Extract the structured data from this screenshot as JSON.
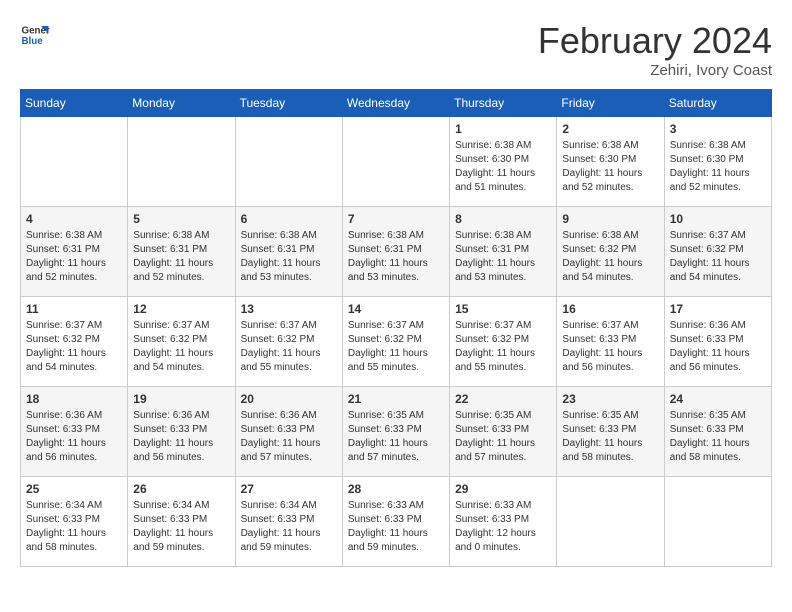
{
  "header": {
    "logo_line1": "General",
    "logo_line2": "Blue",
    "month": "February 2024",
    "location": "Zehiri, Ivory Coast"
  },
  "days_of_week": [
    "Sunday",
    "Monday",
    "Tuesday",
    "Wednesday",
    "Thursday",
    "Friday",
    "Saturday"
  ],
  "weeks": [
    [
      {
        "day": "",
        "detail": ""
      },
      {
        "day": "",
        "detail": ""
      },
      {
        "day": "",
        "detail": ""
      },
      {
        "day": "",
        "detail": ""
      },
      {
        "day": "1",
        "detail": "Sunrise: 6:38 AM\nSunset: 6:30 PM\nDaylight: 11 hours\nand 51 minutes."
      },
      {
        "day": "2",
        "detail": "Sunrise: 6:38 AM\nSunset: 6:30 PM\nDaylight: 11 hours\nand 52 minutes."
      },
      {
        "day": "3",
        "detail": "Sunrise: 6:38 AM\nSunset: 6:30 PM\nDaylight: 11 hours\nand 52 minutes."
      }
    ],
    [
      {
        "day": "4",
        "detail": "Sunrise: 6:38 AM\nSunset: 6:31 PM\nDaylight: 11 hours\nand 52 minutes."
      },
      {
        "day": "5",
        "detail": "Sunrise: 6:38 AM\nSunset: 6:31 PM\nDaylight: 11 hours\nand 52 minutes."
      },
      {
        "day": "6",
        "detail": "Sunrise: 6:38 AM\nSunset: 6:31 PM\nDaylight: 11 hours\nand 53 minutes."
      },
      {
        "day": "7",
        "detail": "Sunrise: 6:38 AM\nSunset: 6:31 PM\nDaylight: 11 hours\nand 53 minutes."
      },
      {
        "day": "8",
        "detail": "Sunrise: 6:38 AM\nSunset: 6:31 PM\nDaylight: 11 hours\nand 53 minutes."
      },
      {
        "day": "9",
        "detail": "Sunrise: 6:38 AM\nSunset: 6:32 PM\nDaylight: 11 hours\nand 54 minutes."
      },
      {
        "day": "10",
        "detail": "Sunrise: 6:37 AM\nSunset: 6:32 PM\nDaylight: 11 hours\nand 54 minutes."
      }
    ],
    [
      {
        "day": "11",
        "detail": "Sunrise: 6:37 AM\nSunset: 6:32 PM\nDaylight: 11 hours\nand 54 minutes."
      },
      {
        "day": "12",
        "detail": "Sunrise: 6:37 AM\nSunset: 6:32 PM\nDaylight: 11 hours\nand 54 minutes."
      },
      {
        "day": "13",
        "detail": "Sunrise: 6:37 AM\nSunset: 6:32 PM\nDaylight: 11 hours\nand 55 minutes."
      },
      {
        "day": "14",
        "detail": "Sunrise: 6:37 AM\nSunset: 6:32 PM\nDaylight: 11 hours\nand 55 minutes."
      },
      {
        "day": "15",
        "detail": "Sunrise: 6:37 AM\nSunset: 6:32 PM\nDaylight: 11 hours\nand 55 minutes."
      },
      {
        "day": "16",
        "detail": "Sunrise: 6:37 AM\nSunset: 6:33 PM\nDaylight: 11 hours\nand 56 minutes."
      },
      {
        "day": "17",
        "detail": "Sunrise: 6:36 AM\nSunset: 6:33 PM\nDaylight: 11 hours\nand 56 minutes."
      }
    ],
    [
      {
        "day": "18",
        "detail": "Sunrise: 6:36 AM\nSunset: 6:33 PM\nDaylight: 11 hours\nand 56 minutes."
      },
      {
        "day": "19",
        "detail": "Sunrise: 6:36 AM\nSunset: 6:33 PM\nDaylight: 11 hours\nand 56 minutes."
      },
      {
        "day": "20",
        "detail": "Sunrise: 6:36 AM\nSunset: 6:33 PM\nDaylight: 11 hours\nand 57 minutes."
      },
      {
        "day": "21",
        "detail": "Sunrise: 6:35 AM\nSunset: 6:33 PM\nDaylight: 11 hours\nand 57 minutes."
      },
      {
        "day": "22",
        "detail": "Sunrise: 6:35 AM\nSunset: 6:33 PM\nDaylight: 11 hours\nand 57 minutes."
      },
      {
        "day": "23",
        "detail": "Sunrise: 6:35 AM\nSunset: 6:33 PM\nDaylight: 11 hours\nand 58 minutes."
      },
      {
        "day": "24",
        "detail": "Sunrise: 6:35 AM\nSunset: 6:33 PM\nDaylight: 11 hours\nand 58 minutes."
      }
    ],
    [
      {
        "day": "25",
        "detail": "Sunrise: 6:34 AM\nSunset: 6:33 PM\nDaylight: 11 hours\nand 58 minutes."
      },
      {
        "day": "26",
        "detail": "Sunrise: 6:34 AM\nSunset: 6:33 PM\nDaylight: 11 hours\nand 59 minutes."
      },
      {
        "day": "27",
        "detail": "Sunrise: 6:34 AM\nSunset: 6:33 PM\nDaylight: 11 hours\nand 59 minutes."
      },
      {
        "day": "28",
        "detail": "Sunrise: 6:33 AM\nSunset: 6:33 PM\nDaylight: 11 hours\nand 59 minutes."
      },
      {
        "day": "29",
        "detail": "Sunrise: 6:33 AM\nSunset: 6:33 PM\nDaylight: 12 hours\nand 0 minutes."
      },
      {
        "day": "",
        "detail": ""
      },
      {
        "day": "",
        "detail": ""
      }
    ]
  ]
}
